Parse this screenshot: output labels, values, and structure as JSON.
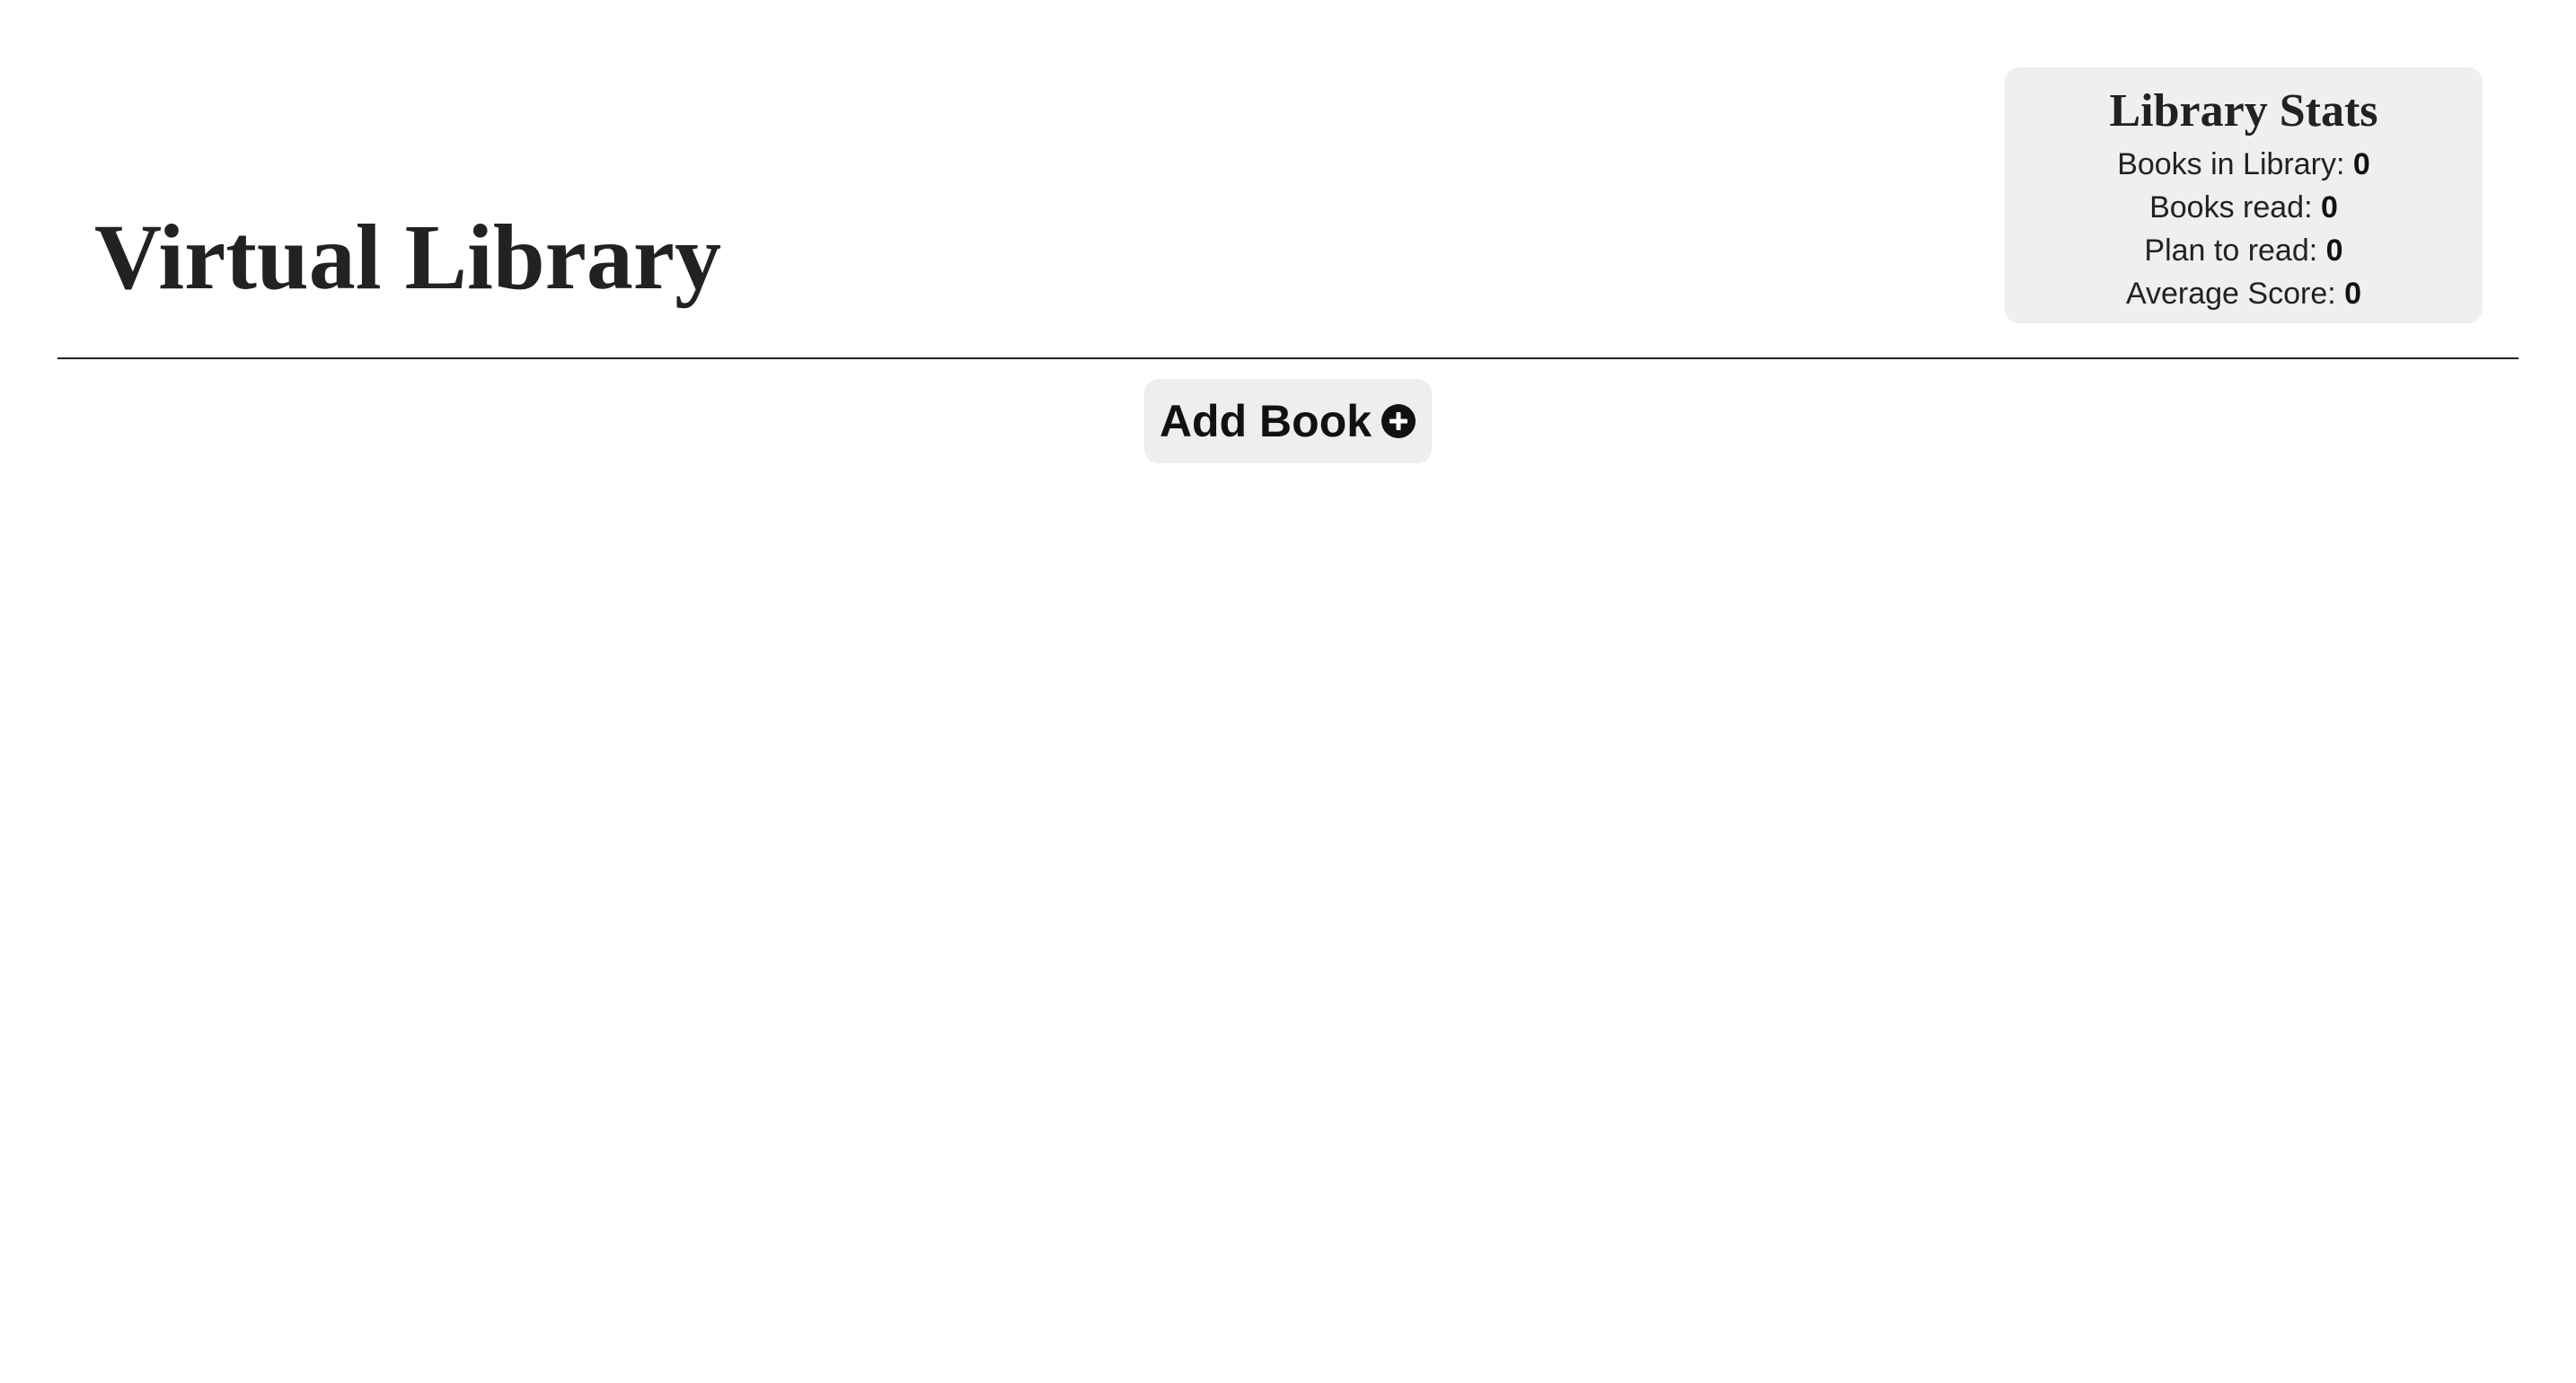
{
  "header": {
    "title": "Virtual Library"
  },
  "stats": {
    "title": "Library Stats",
    "rows": [
      {
        "label": "Books in Library:",
        "value": "0"
      },
      {
        "label": "Books read:",
        "value": "0"
      },
      {
        "label": "Plan to read:",
        "value": "0"
      },
      {
        "label": "Average Score:",
        "value": "0"
      }
    ]
  },
  "actions": {
    "add_book_label": "Add Book",
    "add_book_icon": "plus-circle-icon"
  },
  "colors": {
    "text": "#222222",
    "panel_bg": "#efefef",
    "button_bg": "#eeeeee",
    "page_bg": "#ffffff"
  }
}
